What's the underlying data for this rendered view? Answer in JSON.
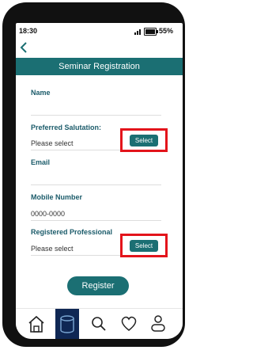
{
  "status": {
    "time": "18:30",
    "battery": "55%"
  },
  "header": {
    "title": "Seminar Registration"
  },
  "form": {
    "name_label": "Name",
    "salutation_label": "Preferred Salutation:",
    "salutation_value": "Please select",
    "salutation_button": "Select",
    "email_label": "Email",
    "mobile_label": "Mobile Number",
    "mobile_value": "0000-0000",
    "professional_label": "Registered Professional",
    "professional_value": "Please select",
    "professional_button": "Select",
    "register_button": "Register"
  },
  "tabs": [
    {
      "icon": "home-icon"
    },
    {
      "icon": "database-icon",
      "active": true
    },
    {
      "icon": "search-icon"
    },
    {
      "icon": "heart-icon"
    },
    {
      "icon": "user-icon"
    }
  ],
  "colors": {
    "accent": "#1b6f73",
    "highlight": "#e3141b",
    "active_tab": "#0f2754"
  }
}
